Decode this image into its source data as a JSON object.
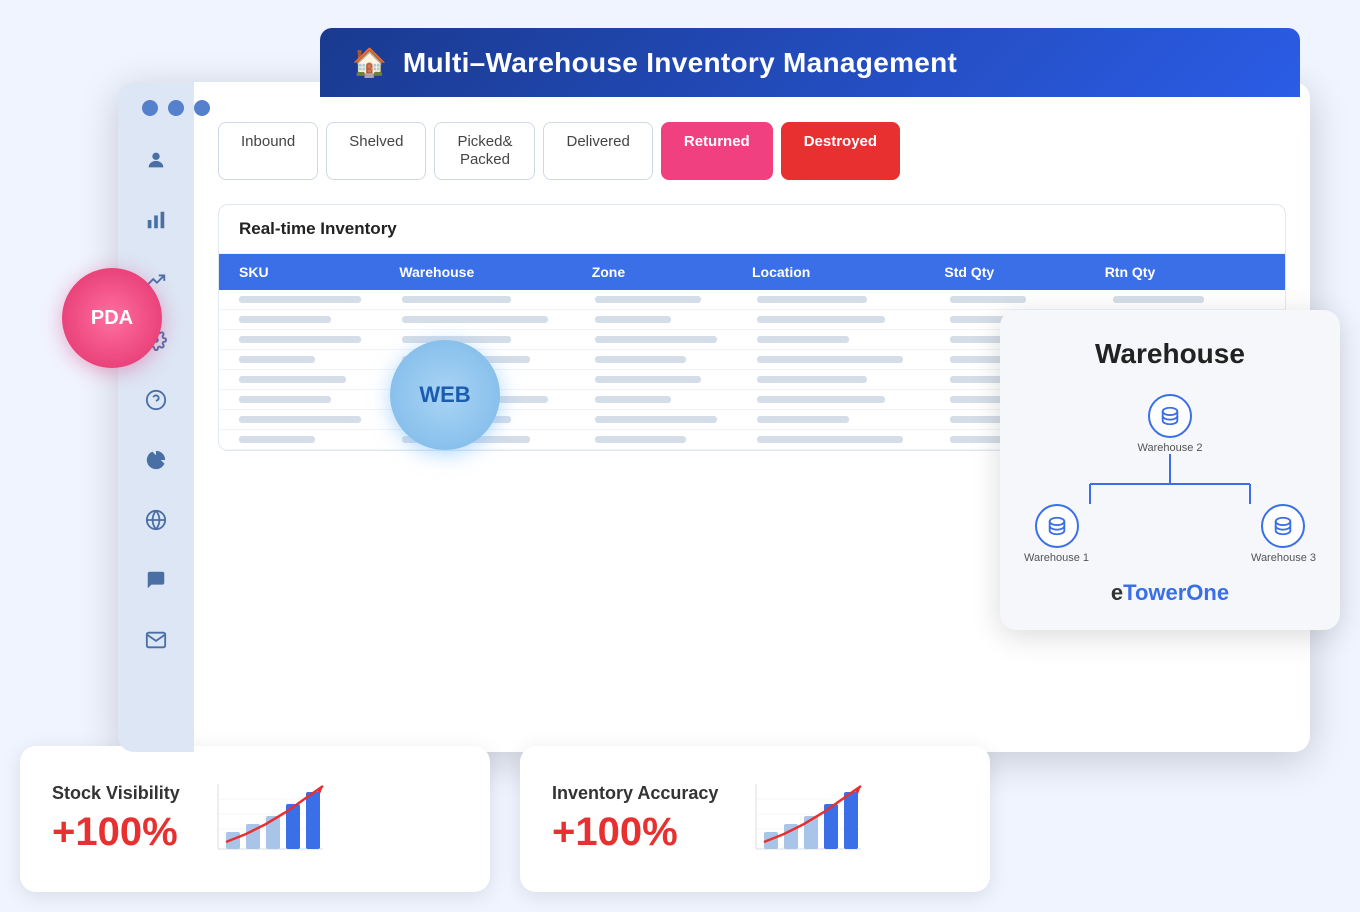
{
  "titleBar": {
    "icon": "🏠",
    "title": "Multi–Warehouse Inventory Management"
  },
  "tabs": [
    {
      "id": "inbound",
      "label": "Inbound",
      "state": "default"
    },
    {
      "id": "shelved",
      "label": "Shelved",
      "state": "default"
    },
    {
      "id": "picked-packed",
      "label": "Picked&\nPacked",
      "state": "default"
    },
    {
      "id": "delivered",
      "label": "Delivered",
      "state": "default"
    },
    {
      "id": "returned",
      "label": "Returned",
      "state": "active-pink"
    },
    {
      "id": "destroyed",
      "label": "Destroyed",
      "state": "active-red"
    }
  ],
  "inventorySection": {
    "title": "Real-time Inventory",
    "columns": [
      "SKU",
      "Warehouse",
      "Zone",
      "Location",
      "Std Qty",
      "Rtn Qty"
    ]
  },
  "sidebarIcons": [
    "👤",
    "📊",
    "📈",
    "⚙️",
    "❓",
    "🥧",
    "🌐",
    "💬",
    "📧"
  ],
  "webBubble": "WEB",
  "pdaBubble": "PDA",
  "warehouseCard": {
    "title": "Warehouse",
    "nodes": [
      {
        "label": "Warehouse 2",
        "position": "top"
      },
      {
        "label": "Warehouse 1",
        "position": "bottom-left"
      },
      {
        "label": "Warehouse 3",
        "position": "bottom-right"
      }
    ],
    "brand": {
      "prefix": "eTower",
      "suffix": "One"
    }
  },
  "statCards": [
    {
      "label": "Stock Visibility",
      "value": "+100%"
    },
    {
      "label": "Inventory Accuracy",
      "value": "+100%"
    }
  ]
}
